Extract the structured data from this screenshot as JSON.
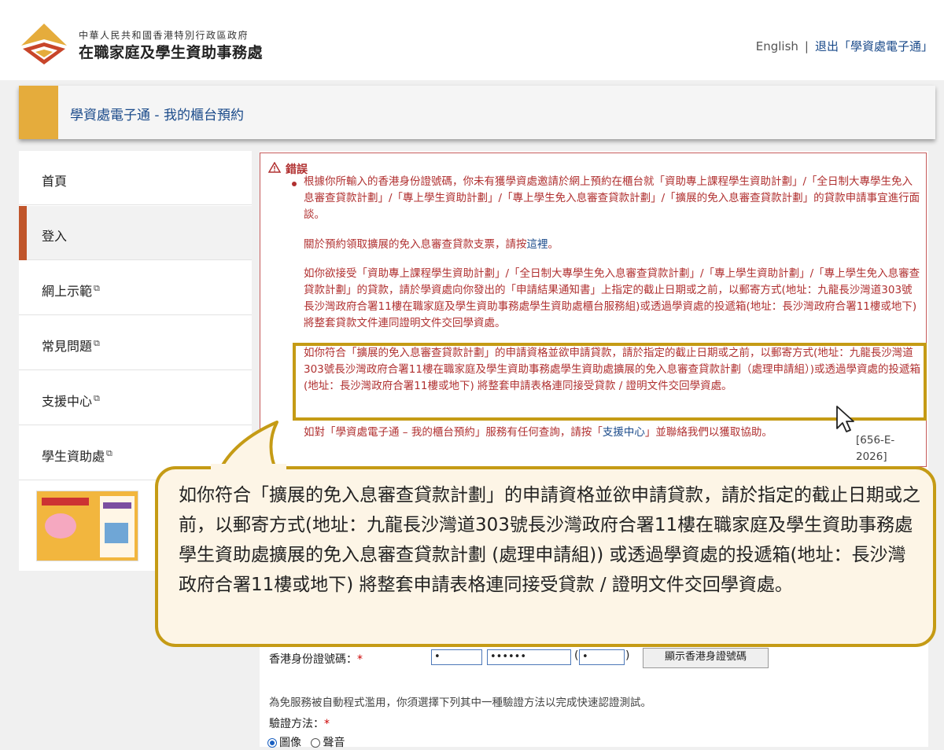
{
  "header": {
    "org_line1": "中華人民共和國香港特別行政區政府",
    "org_line2": "在職家庭及學生資助事務處",
    "lang_link": "English",
    "logout_link": "退出「學資處電子通」"
  },
  "page_title": "學資處電子通 - 我的櫃台預約",
  "sidebar": {
    "items": [
      {
        "label": "首頁"
      },
      {
        "label": "登入"
      },
      {
        "label": "網上示範"
      },
      {
        "label": "常見問題"
      },
      {
        "label": "支援中心"
      },
      {
        "label": "學生資助處"
      }
    ]
  },
  "error": {
    "title": "錯誤",
    "p1": "根據你所輸入的香港身份證號碼，你未有獲學資處邀請於網上預約在櫃台就「資助專上課程學生資助計劃」/「全日制大專學生免入息審查貸款計劃」/「專上學生資助計劃」/「專上學生免入息審查貸款計劃」/「擴展的免入息審查貸款計劃」的貸款申請事宜進行面談。",
    "p2_pre": "關於預約領取擴展的免入息審查貸款支票，請按",
    "p2_link": "這裡",
    "p2_post": "。",
    "p3": "如你欲接受「資助專上課程學生資助計劃」/「全日制大專學生免入息審查貸款計劃」/「專上學生資助計劃」/「專上學生免入息審查貸款計劃」的貸款，請於學資處向你發出的「申請結果通知書」上指定的截止日期或之前，以郵寄方式(地址：九龍長沙灣道303號長沙灣政府合署11樓在職家庭及學生資助事務處學生資助處櫃台服務組)或透過學資處的投遞箱(地址：長沙灣政府合署11樓或地下) 將整套貸款文件連同證明文件交回學資處。",
    "p4": "如你符合「擴展的免入息審查貸款計劃」的申請資格並欲申請貸款，請於指定的截止日期或之前，以郵寄方式(地址：九龍長沙灣道303號長沙灣政府合署11樓在職家庭及學生資助事務處學生資助處擴展的免入息審查貸款計劃（處理申請組）)或透過學資處的投遞箱(地址：長沙灣政府合署11樓或地下) 將整套申請表格連同接受貸款 / 證明文件交回學資處。",
    "p5_pre": "如對「學資處電子通 – 我的櫃台預約」服務有任何查詢，請按「",
    "p5_link": "支援中心",
    "p5_post": "」並聯絡我們以獲取協助。",
    "code": "[656-E-2026]"
  },
  "form": {
    "hkid_label": "香港身份證號碼：",
    "hkid_prefix": "•",
    "hkid_digits": "••••••",
    "hkid_check": "•",
    "show_hkid_button": "顯示香港身證號碼",
    "note": "為免服務被自動程式濫用，你須選擇下列其中一種驗證方法以完成快速認證測試。",
    "verify_label": "驗證方法：",
    "option_image": "圖像",
    "option_audio": "聲音"
  },
  "callout": {
    "text": "如你符合「擴展的免入息審查貸款計劃」的申請資格並欲申請貸款，請於指定的截止日期或之前，以郵寄方式(地址：九龍長沙灣道303號長沙灣政府合署11樓在職家庭及學生資助事務處學生資助處擴展的免入息審查貸款計劃 (處理申請組)) 或透過學資處的投遞箱(地址：長沙灣政府合署11樓或地下) 將整套申請表格連同接受貸款 / 證明文件交回學資處。"
  },
  "colors": {
    "accent": "#e5ac3c",
    "error": "#b03030",
    "link": "#1a4a8a",
    "highlight": "#c59b15",
    "active_bar": "#c0552b"
  }
}
